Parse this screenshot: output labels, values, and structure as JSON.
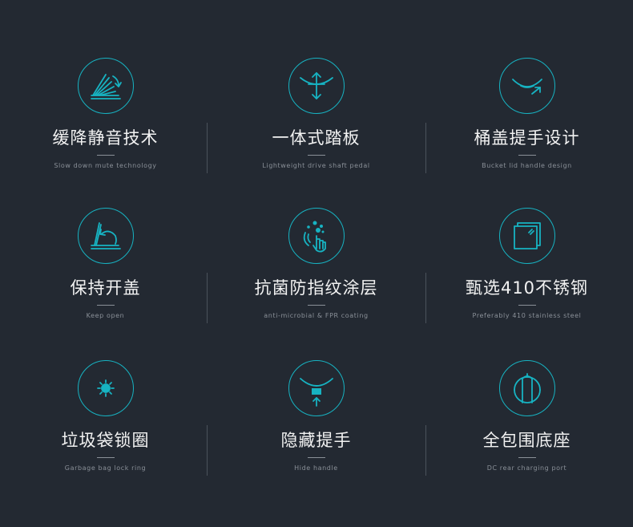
{
  "features": [
    {
      "title": "缓降静音技术",
      "subtitle": "Slow down mute technology",
      "icon": "slow-close-icon"
    },
    {
      "title": "一体式踏板",
      "subtitle": "Lightweight drive shaft pedal",
      "icon": "pedal-icon"
    },
    {
      "title": "桶盖提手设计",
      "subtitle": "Bucket lid handle design",
      "icon": "lid-handle-icon"
    },
    {
      "title": "保持开盖",
      "subtitle": "Keep open",
      "icon": "keep-open-icon"
    },
    {
      "title": "抗菌防指纹涂层",
      "subtitle": "anti-microbial & FPR coating",
      "icon": "antimicrobial-icon"
    },
    {
      "title": "甄选410不锈钢",
      "subtitle": "Preferably 410 stainless steel",
      "icon": "stainless-steel-icon"
    },
    {
      "title": "垃圾袋锁圈",
      "subtitle": "Garbage bag lock ring",
      "icon": "lock-ring-icon"
    },
    {
      "title": "隐藏提手",
      "subtitle": "Hide handle",
      "icon": "hidden-handle-icon"
    },
    {
      "title": "全包围底座",
      "subtitle": "DC rear charging port",
      "icon": "base-icon"
    }
  ],
  "colors": {
    "background": "#232932",
    "accent": "#17b3c2",
    "title": "#f2f2f2",
    "subtitle": "#8a9098",
    "divider": "#4b525b"
  }
}
